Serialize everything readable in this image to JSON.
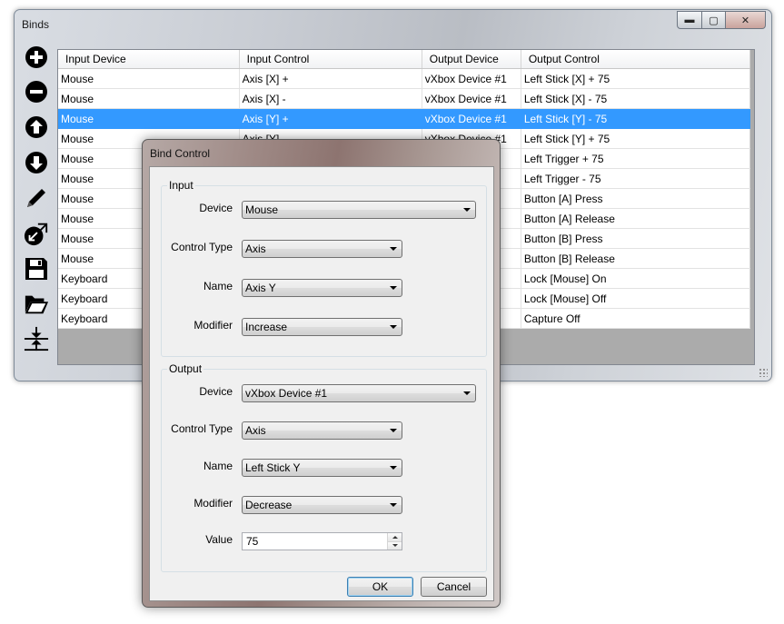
{
  "main_window": {
    "title": "Binds",
    "controls": {
      "minimize": "▬",
      "maximize": "▢",
      "close": "✕"
    }
  },
  "toolbar": {
    "items": [
      {
        "name": "add-icon"
      },
      {
        "name": "remove-icon"
      },
      {
        "name": "move-up-icon"
      },
      {
        "name": "move-down-icon"
      },
      {
        "name": "edit-pencil-icon"
      },
      {
        "name": "capture-icon"
      },
      {
        "name": "save-floppy-icon"
      },
      {
        "name": "open-folder-icon"
      },
      {
        "name": "collapse-icon"
      }
    ]
  },
  "grid": {
    "columns": [
      "Input Device",
      "Input Control",
      "Output Device",
      "Output Control"
    ],
    "selected_row": 2,
    "selection_color": "#3399ff",
    "rows": [
      [
        "Mouse",
        "Axis [X] +",
        "vXbox Device #1",
        "Left Stick [X] + 75"
      ],
      [
        "Mouse",
        "Axis [X] -",
        "vXbox Device #1",
        "Left Stick [X] - 75"
      ],
      [
        "Mouse",
        "Axis [Y] +",
        "vXbox Device #1",
        "Left Stick [Y] - 75"
      ],
      [
        "Mouse",
        "Axis [Y] -",
        "vXbox Device #1",
        "Left Stick [Y] + 75"
      ],
      [
        "Mouse",
        "",
        "",
        "Left Trigger + 75"
      ],
      [
        "Mouse",
        "",
        "",
        "Left Trigger - 75"
      ],
      [
        "Mouse",
        "",
        "",
        "Button [A] Press"
      ],
      [
        "Mouse",
        "",
        "",
        "Button [A] Release"
      ],
      [
        "Mouse",
        "",
        "",
        "Button [B] Press"
      ],
      [
        "Mouse",
        "",
        "",
        "Button [B] Release"
      ],
      [
        "Keyboard",
        "",
        "",
        "Lock [Mouse] On"
      ],
      [
        "Keyboard",
        "",
        "",
        "Lock [Mouse] Off"
      ],
      [
        "Keyboard",
        "",
        "",
        "Capture Off"
      ]
    ]
  },
  "dialog": {
    "title": "Bind Control",
    "input": {
      "group_label": "Input",
      "device_label": "Device",
      "device_value": "Mouse",
      "control_type_label": "Control Type",
      "control_type_value": "Axis",
      "name_label": "Name",
      "name_value": "Axis Y",
      "modifier_label": "Modifier",
      "modifier_value": "Increase"
    },
    "output": {
      "group_label": "Output",
      "device_label": "Device",
      "device_value": "vXbox Device #1",
      "control_type_label": "Control Type",
      "control_type_value": "Axis",
      "name_label": "Name",
      "name_value": "Left Stick Y",
      "modifier_label": "Modifier",
      "modifier_value": "Decrease",
      "value_label": "Value",
      "value_value": "75"
    },
    "ok_label": "OK",
    "cancel_label": "Cancel"
  }
}
